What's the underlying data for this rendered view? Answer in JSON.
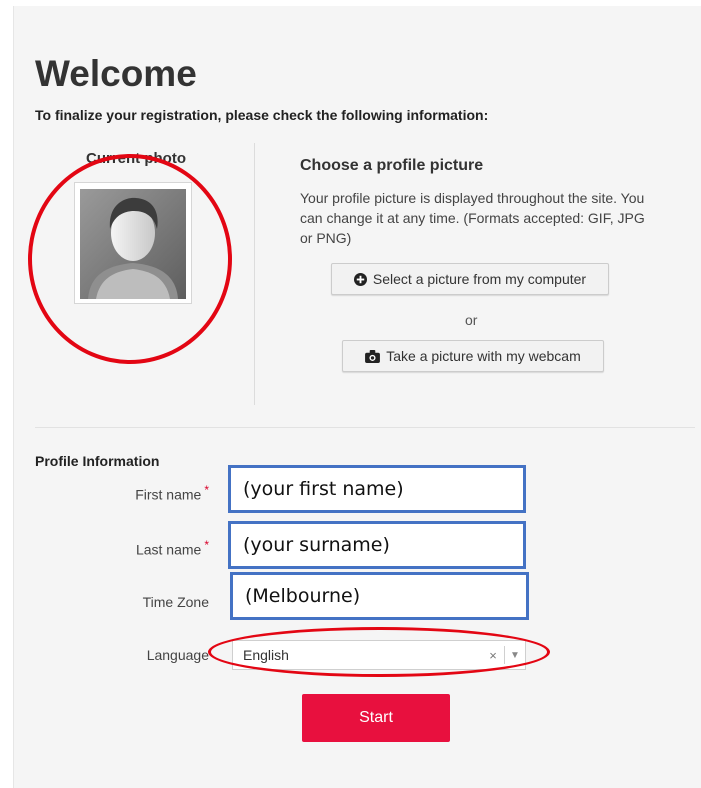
{
  "page": {
    "title": "Welcome",
    "subtitle": "To finalize your registration, please check the following information:"
  },
  "photo": {
    "label": "Current photo",
    "image_icon": "default-avatar-icon"
  },
  "profile_picture": {
    "title": "Choose a profile picture",
    "description": "Your profile picture is displayed throughout the site. You can change it at any time. (Formats accepted: GIF, JPG or PNG)",
    "select_button": "Select a picture from my computer",
    "select_icon": "plus-circle-icon",
    "or_text": "or",
    "webcam_button": "Take a picture with my webcam",
    "webcam_icon": "camera-icon"
  },
  "profile_info": {
    "title": "Profile Information",
    "required_mark": "*",
    "first_name": {
      "label": "First name",
      "value": "(your first name)"
    },
    "last_name": {
      "label": "Last name",
      "value": "(your surname)"
    },
    "time_zone": {
      "label": "Time Zone",
      "value": "(Melbourne)"
    },
    "language": {
      "label": "Language",
      "value": "English",
      "clear_glyph": "×",
      "arrow_glyph": "▼"
    }
  },
  "actions": {
    "start_button": "Start"
  },
  "colors": {
    "accent_red": "#e8103e",
    "annotation_red": "#e30613",
    "annotation_blue": "#4472c4",
    "panel_bg": "#f5f5f5"
  }
}
